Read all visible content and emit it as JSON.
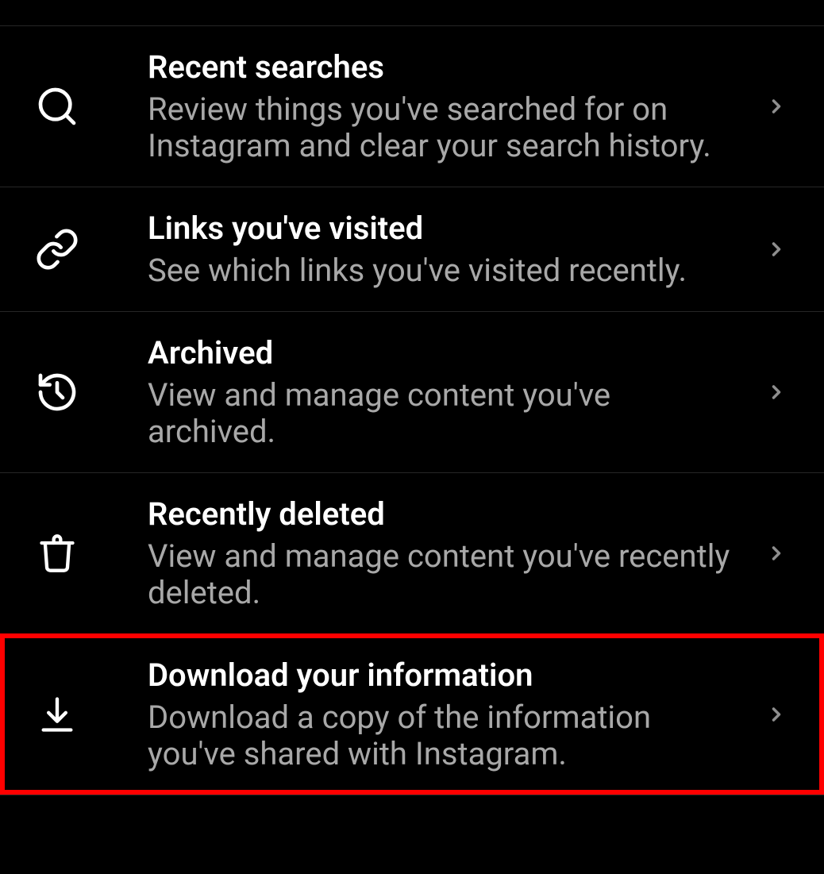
{
  "items": [
    {
      "title": "Recent searches",
      "subtitle": "Review things you've searched for on Instagram and clear your search history."
    },
    {
      "title": "Links you've visited",
      "subtitle": "See which links you've visited recently."
    },
    {
      "title": "Archived",
      "subtitle": "View and manage content you've archived."
    },
    {
      "title": "Recently deleted",
      "subtitle": "View and manage content you've recently deleted."
    },
    {
      "title": "Download your information",
      "subtitle": "Download a copy of the information you've shared with Instagram."
    }
  ]
}
